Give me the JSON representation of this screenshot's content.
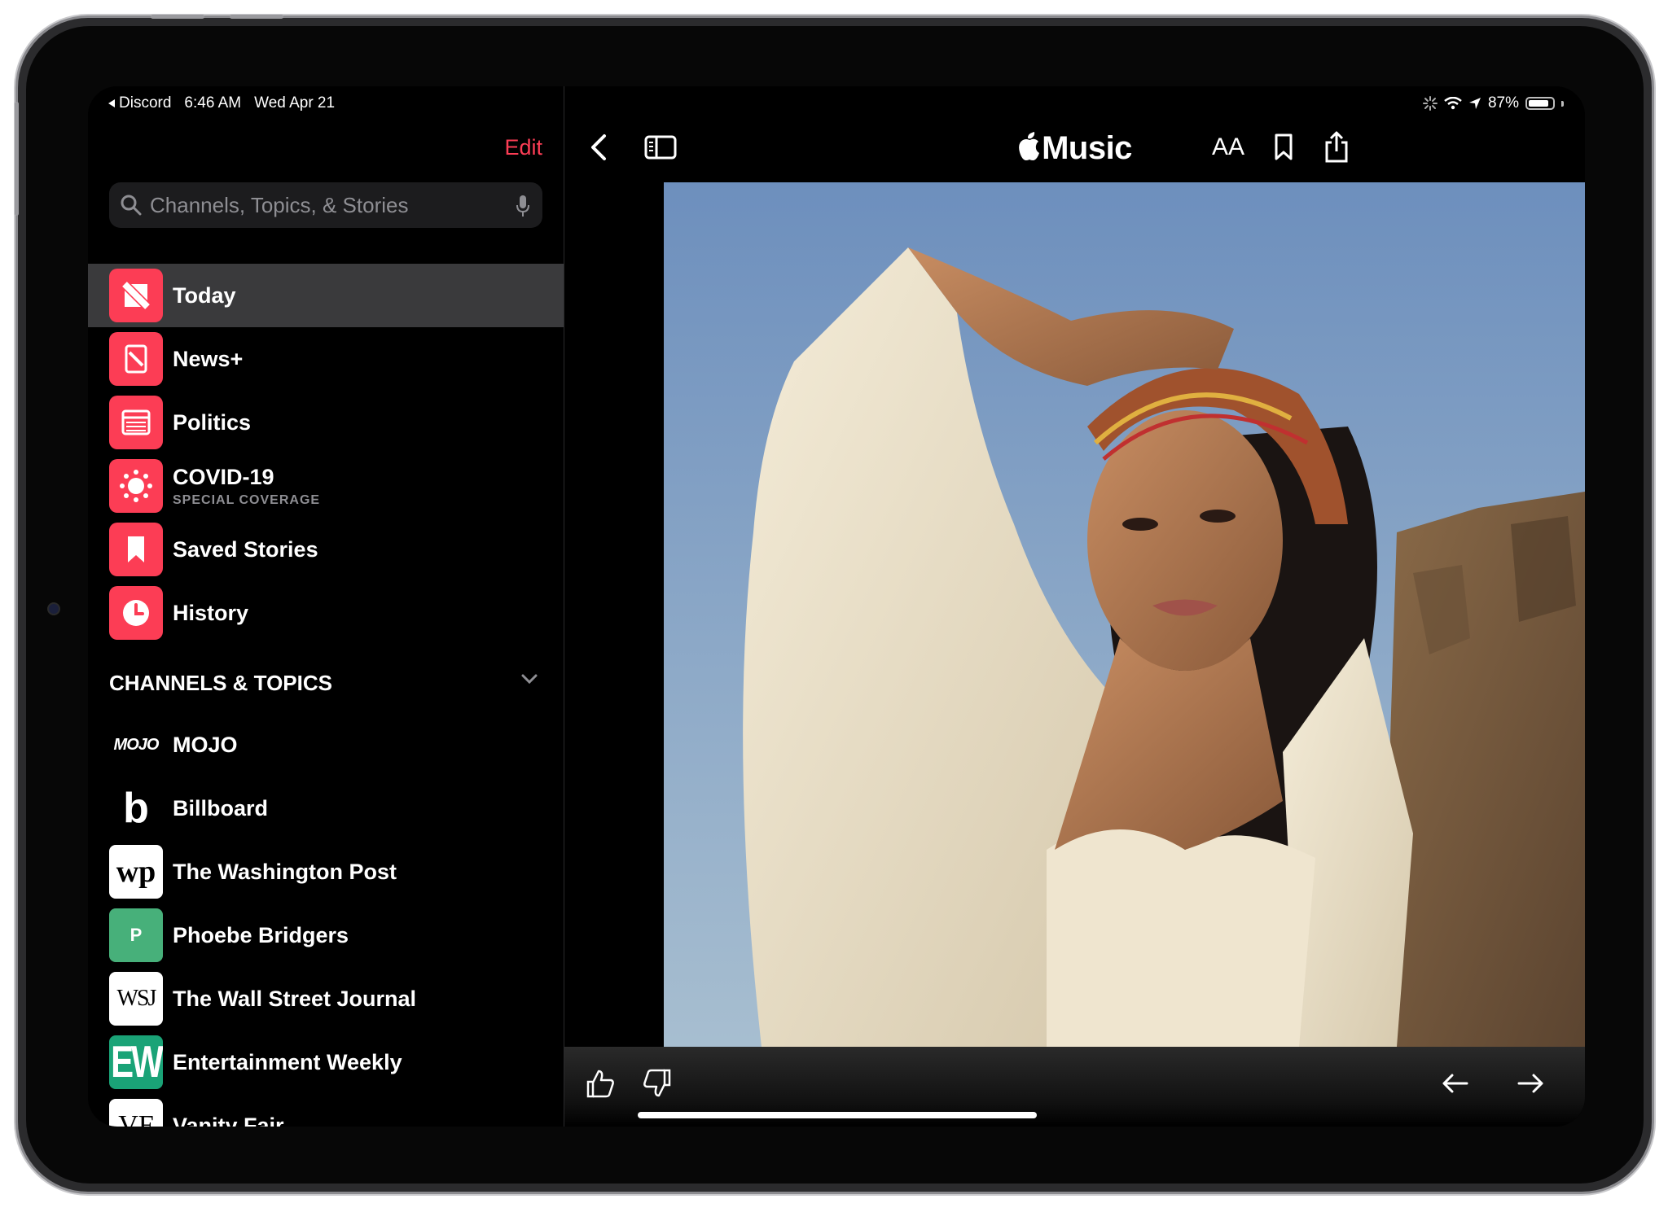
{
  "status_bar": {
    "back_app": "Discord",
    "time": "6:46 AM",
    "date": "Wed Apr 21",
    "battery": "87%",
    "battery_level": 0.87
  },
  "sidebar": {
    "edit_label": "Edit",
    "search_placeholder": "Channels, Topics, & Stories",
    "nav": [
      {
        "label": "Today",
        "icon": "news-logo-icon",
        "active": true,
        "color": "#fc3d55"
      },
      {
        "label": "News+",
        "icon": "newsplus-icon",
        "color": "#fc3d55"
      },
      {
        "label": "Politics",
        "icon": "politics-icon",
        "color": "#fc3d55"
      },
      {
        "label": "COVID-19",
        "sub": "SPECIAL COVERAGE",
        "icon": "covid-icon",
        "color": "#fc3d55"
      },
      {
        "label": "Saved Stories",
        "icon": "bookmark-icon",
        "color": "#fc3d55"
      },
      {
        "label": "History",
        "icon": "clock-icon",
        "color": "#fc3d55"
      }
    ],
    "section_title": "CHANNELS & TOPICS",
    "channels": [
      {
        "label": "MOJO",
        "logo": "MOJO"
      },
      {
        "label": "Billboard",
        "logo": "b"
      },
      {
        "label": "The Washington Post",
        "logo": "wp"
      },
      {
        "label": "Phoebe Bridgers",
        "logo": "P"
      },
      {
        "label": "The Wall Street Journal",
        "logo": "WSJ"
      },
      {
        "label": "Entertainment Weekly",
        "logo": "EW"
      },
      {
        "label": "Vanity Fair",
        "logo": "VF"
      }
    ]
  },
  "content": {
    "brand": "Music",
    "aa_label": "AA",
    "accent": "#fc3d55"
  }
}
